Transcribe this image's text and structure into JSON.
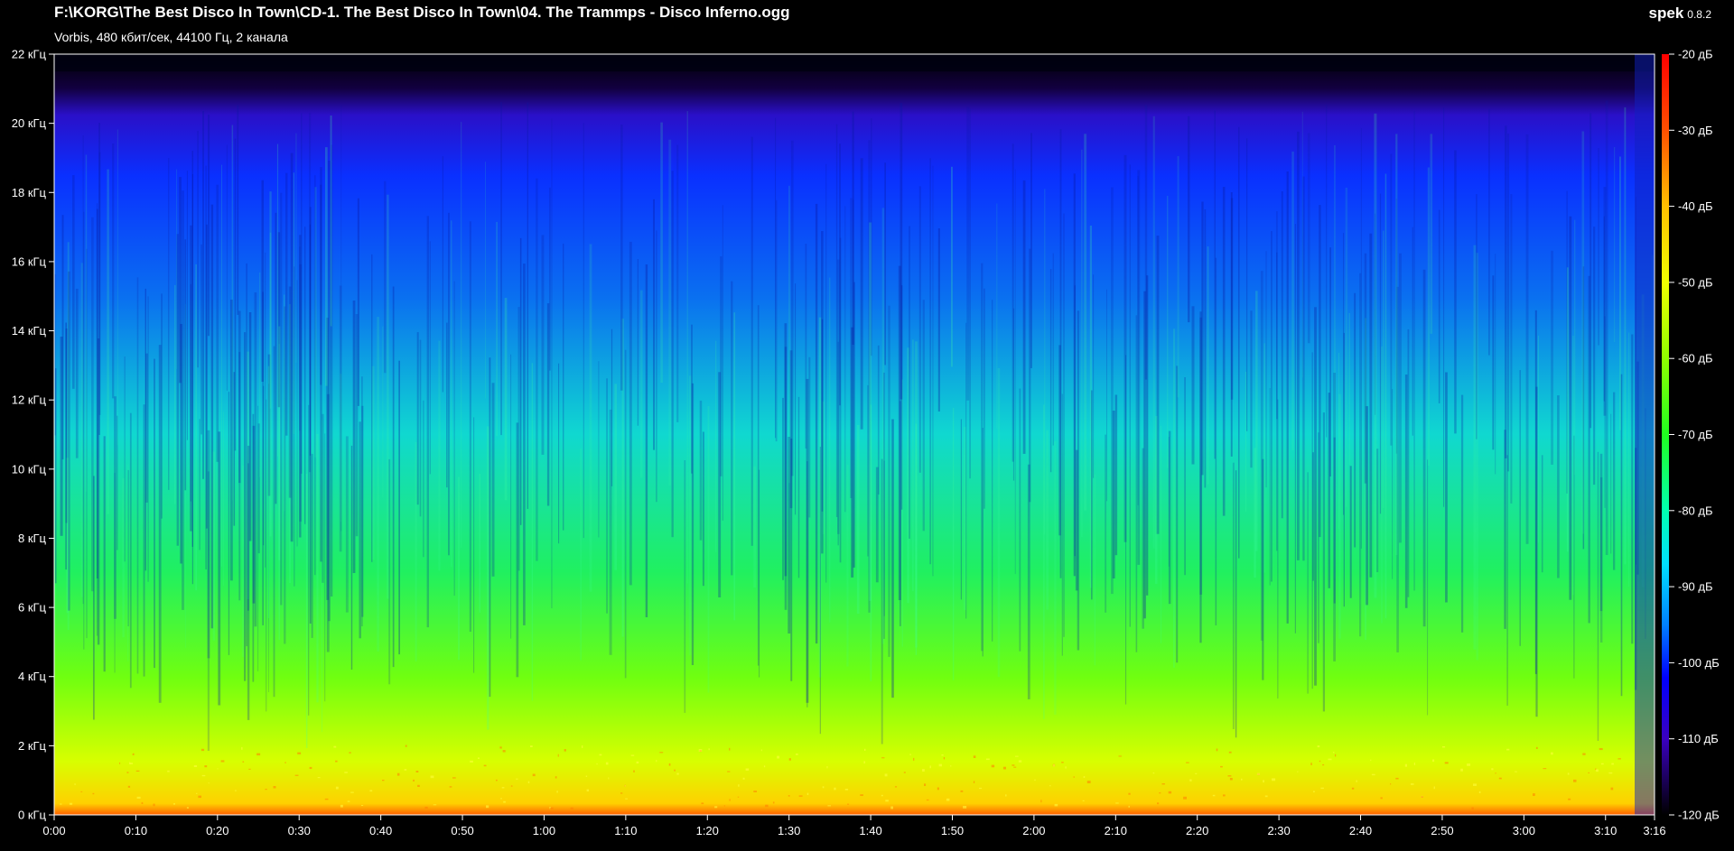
{
  "header": {
    "title": "F:\\KORG\\The Best Disco In Town\\CD-1. The Best Disco In Town\\04. The Trammps - Disco Inferno.ogg",
    "subtitle": "Vorbis, 480 кбит/сек, 44100 Гц, 2 канала",
    "app_name": "spek",
    "app_version": "0.8.2"
  },
  "colors": {
    "background": "#000000",
    "axis": "#ffffff",
    "palette": [
      "#000000",
      "#1a0060",
      "#3a00c0",
      "#0000ff",
      "#0090ff",
      "#00f0ff",
      "#00ff60",
      "#7aff00",
      "#ffff00",
      "#ff8000",
      "#ff1000"
    ]
  },
  "chart_data": {
    "type": "heatmap",
    "duration_seconds": 196,
    "x_ticks": [
      "0:00",
      "0:10",
      "0:20",
      "0:30",
      "0:40",
      "0:50",
      "1:00",
      "1:10",
      "1:20",
      "1:30",
      "1:40",
      "1:50",
      "2:00",
      "2:10",
      "2:20",
      "2:30",
      "2:40",
      "2:50",
      "3:00",
      "3:10",
      "3:16"
    ],
    "x_tick_seconds": [
      0,
      10,
      20,
      30,
      40,
      50,
      60,
      70,
      80,
      90,
      100,
      110,
      120,
      130,
      140,
      150,
      160,
      170,
      180,
      190,
      196
    ],
    "y_ticks": [
      "0 кГц",
      "2 кГц",
      "4 кГц",
      "6 кГц",
      "8 кГц",
      "10 кГц",
      "12 кГц",
      "14 кГц",
      "16 кГц",
      "18 кГц",
      "20 кГц",
      "22 кГц"
    ],
    "y_tick_khz": [
      0,
      2,
      4,
      6,
      8,
      10,
      12,
      14,
      16,
      18,
      20,
      22
    ],
    "ylim_khz": [
      0,
      22
    ],
    "colorbar_ticks": [
      "-20 дБ",
      "-30 дБ",
      "-40 дБ",
      "-50 дБ",
      "-60 дБ",
      "-70 дБ",
      "-80 дБ",
      "-90 дБ",
      "-100 дБ",
      "-110 дБ",
      "-120 дБ"
    ],
    "colorbar_db": [
      -20,
      -30,
      -40,
      -50,
      -60,
      -70,
      -80,
      -90,
      -100,
      -110,
      -120
    ],
    "db_range": [
      -120,
      -20
    ],
    "cutoff_khz": 21.5
  }
}
